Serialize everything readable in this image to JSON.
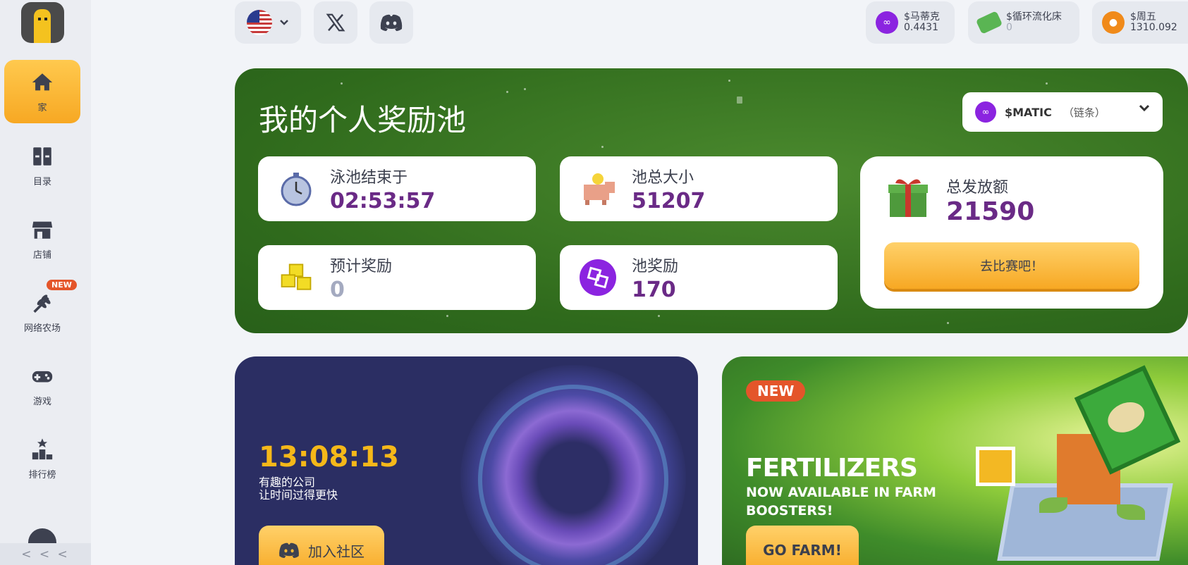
{
  "sidebar": {
    "items": [
      {
        "label": "家",
        "icon": "home-icon",
        "active": true
      },
      {
        "label": "目录",
        "icon": "catalog-icon"
      },
      {
        "label": "店铺",
        "icon": "shop-icon"
      },
      {
        "label": "网络农场",
        "icon": "wheat-icon",
        "badge": "NEW"
      },
      {
        "label": "游戏",
        "icon": "gamepad-icon"
      },
      {
        "label": "排行榜",
        "icon": "leaderboard-icon"
      }
    ],
    "collapse_label": "< < <"
  },
  "topbar": {
    "language_icon": "us-flag-icon",
    "social": [
      "x-icon",
      "discord-icon"
    ],
    "tokens": [
      {
        "name": "$马蒂克",
        "value": "0.4431",
        "color": "#8b24e0"
      },
      {
        "name": "$循环流化床",
        "value": "0",
        "color": "#5ab553"
      },
      {
        "name": "$周五",
        "value": "1310.092",
        "color": "#f08a1a"
      }
    ]
  },
  "pool": {
    "title": "我的个人奖励池",
    "chain_symbol": "$MATIC",
    "chain_note": "（链条）",
    "stats": {
      "ends_label": "泳池结束于",
      "ends_value": "02:53:57",
      "size_label": "池总大小",
      "size_value": "51207",
      "expected_label": "预计奖励",
      "expected_value": "0",
      "pool_reward_label": "池奖励",
      "pool_reward_value": "170"
    },
    "total_label": "总发放额",
    "total_value": "21590",
    "compete_button": "去比赛吧！"
  },
  "banner_discord": {
    "timer": "13:08:13",
    "slogan_line1": "有趣的公司",
    "slogan_line2": "让时间过得更快",
    "join_button": "加入社区"
  },
  "banner_farm": {
    "badge": "NEW",
    "title": "FERTILIZERS",
    "subtitle": "NOW AVAILABLE IN FARM BOOSTERS!",
    "button": "GO FARM!"
  }
}
